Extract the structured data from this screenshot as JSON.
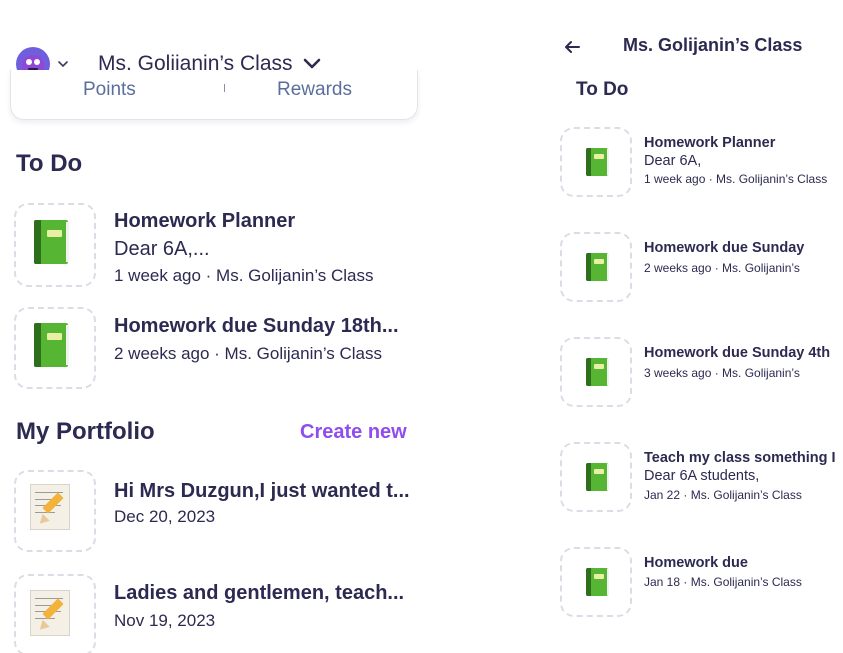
{
  "left": {
    "header": {
      "class_name": "Ms. Golijanin’s Class"
    },
    "tabs": {
      "points": "Points",
      "separator": "'",
      "rewards": "Rewards"
    },
    "todo": {
      "title": "To Do",
      "items": [
        {
          "title": "Homework Planner",
          "line": "Dear 6A,...",
          "meta": "1 week ago · Ms. Golijanin’s Class",
          "icon": "book-icon"
        },
        {
          "title": "Homework due Sunday 18th...",
          "meta": "2 weeks ago · Ms. Golijanin’s Class",
          "icon": "book-icon"
        }
      ]
    },
    "portfolio": {
      "title": "My Portfolio",
      "create_new": "Create new",
      "items": [
        {
          "title": "Hi Mrs Duzgun,I just wanted t...",
          "date": "Dec 20, 2023",
          "icon": "note-pencil-icon"
        },
        {
          "title": "Ladies and gentlemen, teach...",
          "date": "Nov 19, 2023",
          "icon": "note-pencil-icon"
        }
      ]
    }
  },
  "right": {
    "header": {
      "title": "Ms. Golijanin’s Class",
      "back_icon": "back-arrow-icon"
    },
    "todo": {
      "title": "To Do",
      "items": [
        {
          "title": "Homework Planner",
          "line": "Dear 6A,",
          "meta": "1 week ago · Ms. Golijanin’s Class"
        },
        {
          "title": "Homework due Sunday",
          "meta": "2 weeks ago · Ms. Golijanin’s"
        },
        {
          "title": "Homework due Sunday 4th",
          "meta": "3 weeks ago · Ms. Golijanin’s"
        },
        {
          "title": "Teach my class something I",
          "line": "Dear 6A students,",
          "meta": "Jan 22 · Ms. Golijanin’s Class"
        },
        {
          "title": "Homework due",
          "meta": "Jan 18 · Ms. Golijanin’s Class"
        }
      ]
    }
  },
  "colors": {
    "accent": "#8f4df0",
    "text": "#2c2a50",
    "tab_text": "#5a6e9e",
    "book_green": "#56b532"
  }
}
